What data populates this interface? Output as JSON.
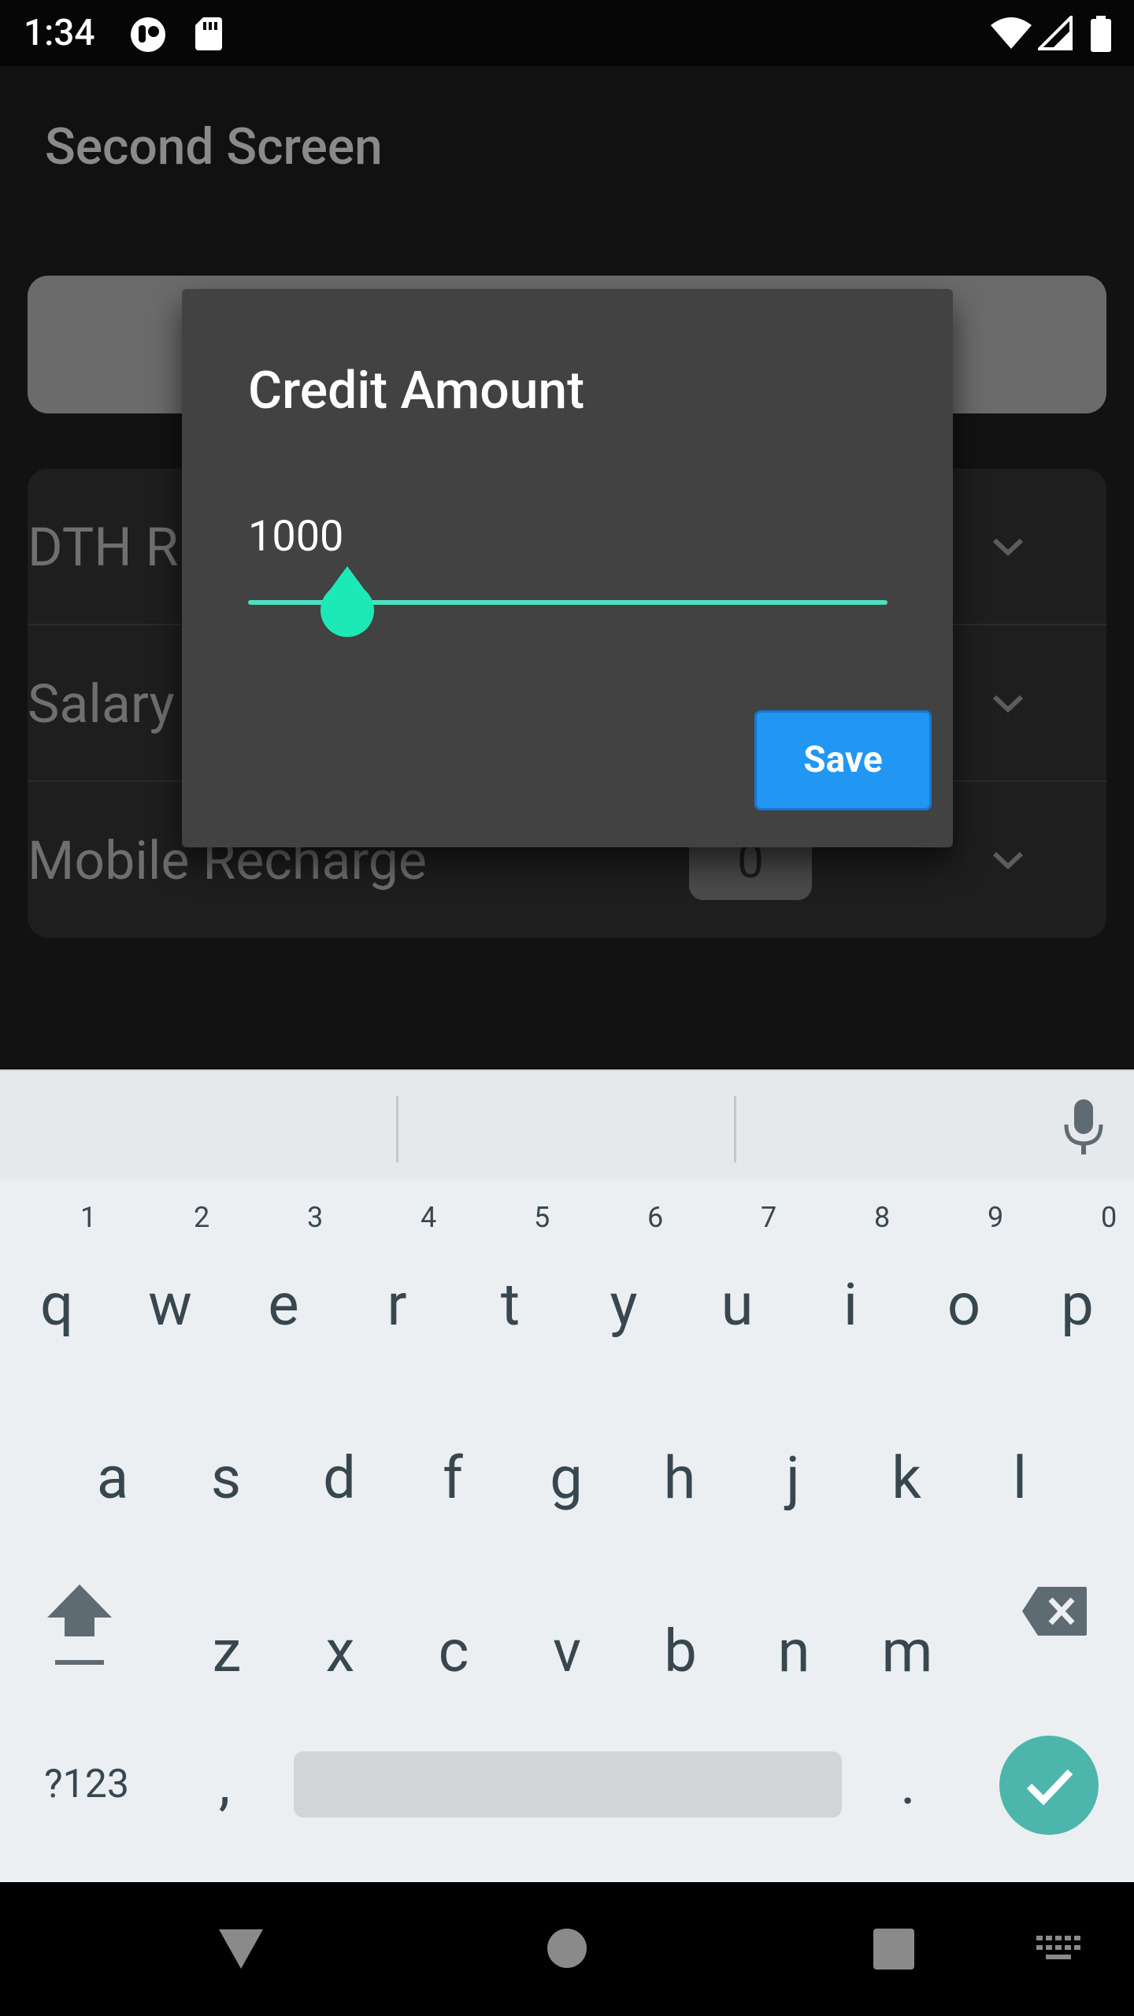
{
  "status_bar": {
    "time": "1:34",
    "left_icons": [
      "app-notification-icon",
      "sd-card-icon"
    ],
    "right_icons": [
      "wifi-icon",
      "cell-signal-icon",
      "battery-icon"
    ]
  },
  "app_bar": {
    "title": "Second Screen"
  },
  "list": {
    "rows": [
      {
        "label": "DTH R"
      },
      {
        "label": "Salary"
      },
      {
        "label": "Mobile Recharge",
        "value": "0"
      }
    ]
  },
  "fab": {
    "label": "+"
  },
  "dialog": {
    "title": "Credit Amount",
    "slider": {
      "value": "1000",
      "position": 0.155
    },
    "save_label": "Save",
    "accent_color": "#2196f3",
    "slider_color": "#1de9b6"
  },
  "keyboard": {
    "row1": [
      {
        "key": "q",
        "hint": "1"
      },
      {
        "key": "w",
        "hint": "2"
      },
      {
        "key": "e",
        "hint": "3"
      },
      {
        "key": "r",
        "hint": "4"
      },
      {
        "key": "t",
        "hint": "5"
      },
      {
        "key": "y",
        "hint": "6"
      },
      {
        "key": "u",
        "hint": "7"
      },
      {
        "key": "i",
        "hint": "8"
      },
      {
        "key": "o",
        "hint": "9"
      },
      {
        "key": "p",
        "hint": "0"
      }
    ],
    "row2": [
      "a",
      "s",
      "d",
      "f",
      "g",
      "h",
      "j",
      "k",
      "l"
    ],
    "row3": [
      "z",
      "x",
      "c",
      "v",
      "b",
      "n",
      "m"
    ],
    "symbols_label": "?123",
    "comma": ",",
    "period": "."
  },
  "nav_bar": {
    "items": [
      "back-icon",
      "home-icon",
      "recents-icon",
      "keyboard-switch-icon"
    ]
  }
}
